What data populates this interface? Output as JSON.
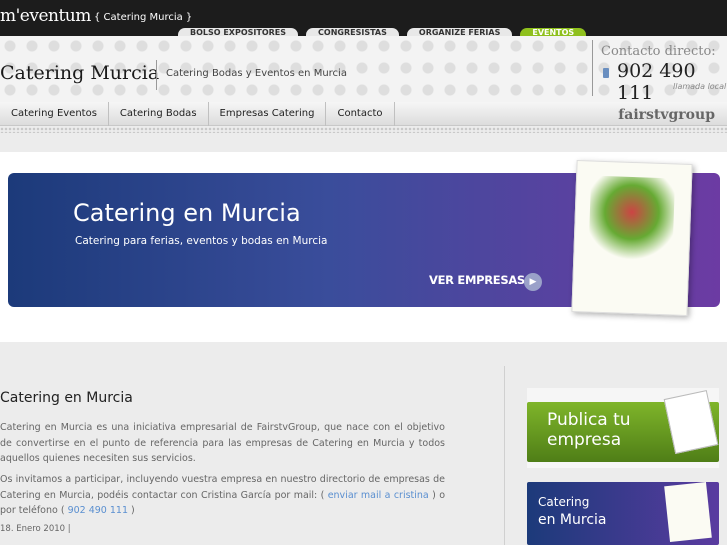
{
  "topbar": {
    "logo": "m'eventum",
    "site_tag": "{ Catering Murcia }",
    "tabs": [
      "BOLSO EXPOSITORES",
      "CONGRESISTAS",
      "ORGANIZE FERIAS",
      "EVENTOS"
    ]
  },
  "header": {
    "title": "Catering Murcia",
    "subtitle": "Catering Bodas y Eventos en Murcia",
    "contact_label": "Contacto directo:",
    "phone": "902 490 111",
    "phone_note": "llamada local"
  },
  "nav": {
    "items": [
      "Catering Eventos",
      "Catering Bodas",
      "Empresas Catering",
      "Contacto"
    ],
    "brand": "fairstvgroup"
  },
  "banner": {
    "title": "Catering en Murcia",
    "subtitle": "Catering para ferias, eventos y bodas en Murcia",
    "cta": "VER EMPRESAS",
    "cta_arrow": "▶"
  },
  "post": {
    "title": "Catering en Murcia",
    "para1": "Catering en Murcia es una iniciativa empresarial de FairstvGroup, que nace con el objetivo de convertirse en el punto de referencia para las empresas de Catering en Murcia y todos aquellos quienes necesiten sus servicios.",
    "para2_a": "Os invitamos a participar, incluyendo vuestra empresa en nuestro directorio de empresas de Catering en Murcia, podéis contactar con Cristina García por mail: ( ",
    "para2_link1": "enviar mail a cristina",
    "para2_b": " ) o por teléfono ( ",
    "para2_link2": "902 490 111",
    "para2_c": " )",
    "date": "18. Enero 2010 |"
  },
  "sidebar": {
    "ad1_line1": "Publica tu",
    "ad1_line2": "empresa",
    "ad2_line1": "Catering",
    "ad2_line2": "en Murcia"
  }
}
